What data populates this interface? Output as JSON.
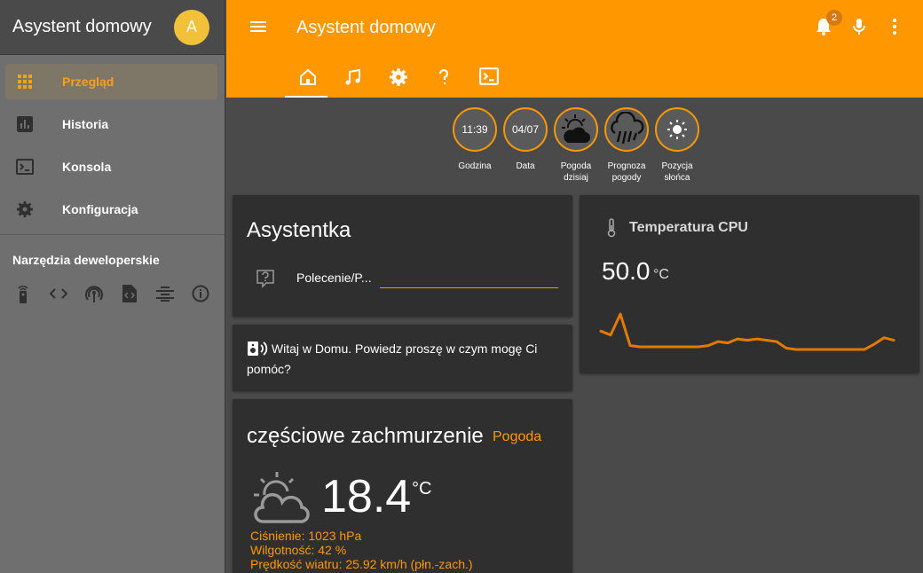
{
  "sidebar": {
    "title": "Asystent domowy",
    "avatar_letter": "A",
    "items": [
      {
        "label": "Przegląd",
        "icon": "apps-grid-icon"
      },
      {
        "label": "Historia",
        "icon": "chart-bar-icon"
      },
      {
        "label": "Konsola",
        "icon": "console-icon"
      },
      {
        "label": "Konfiguracja",
        "icon": "gear-icon"
      }
    ],
    "dev_title": "Narzędzia deweloperskie",
    "dev_icons": [
      "remote-icon",
      "code-icon",
      "broadcast-icon",
      "file-code-icon",
      "list-icon",
      "info-icon"
    ]
  },
  "header": {
    "title": "Asystent domowy",
    "notification_count": "2",
    "tabs": [
      "home-icon",
      "music-icon",
      "gear-icon",
      "help-icon",
      "console-icon"
    ]
  },
  "badges": [
    {
      "value": "11:39",
      "label": "Godzina"
    },
    {
      "value": "04/07",
      "label": "Data"
    },
    {
      "value": "",
      "label": "Pogoda dzisiaj",
      "icon": "partly-cloudy-icon"
    },
    {
      "value": "",
      "label": "Prognoza pogody",
      "icon": "rain-cloud-icon"
    },
    {
      "value": "",
      "label": "Pozycja słońca",
      "icon": "sun-icon"
    }
  ],
  "assistant": {
    "title": "Asystentka",
    "input_label": "Polecenie/P..."
  },
  "welcome": {
    "text": "Witaj w Domu. Powiedz proszę w czym mogę Ci pomóc?"
  },
  "weather": {
    "condition": "częściowe zachmurzenie",
    "link": "Pogoda",
    "temperature": "18.4",
    "unit": "°C",
    "pressure": "Ciśnienie: 1023 hPa",
    "humidity": "Wilgotność: 42 %",
    "wind": "Prędkość wiatru: 25.92 km/h (płn.-zach.)"
  },
  "cpu": {
    "title": "Temperatura CPU",
    "value": "50.0",
    "unit": "°C",
    "history": [
      50.5,
      50.2,
      51.8,
      49.4,
      49.3,
      49.3,
      49.3,
      49.3,
      49.3,
      49.3,
      49.3,
      49.4,
      49.7,
      49.6,
      49.9,
      49.8,
      49.9,
      49.8,
      49.7,
      49.2,
      49.1,
      49.1,
      49.1,
      49.1,
      49.1,
      49.1,
      49.1,
      49.1,
      49.5,
      50.0,
      49.8
    ],
    "accent": "#e07b00"
  },
  "colors": {
    "accent": "#ff9800"
  }
}
